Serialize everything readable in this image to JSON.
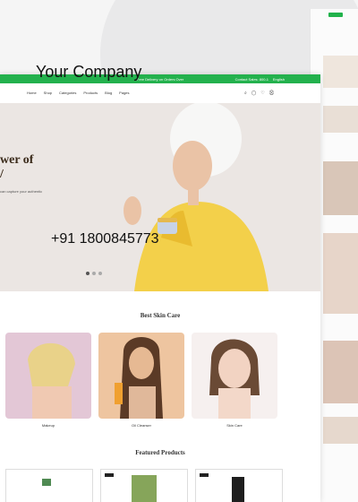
{
  "overlay": {
    "company": "Your Company",
    "phone": "+91 1800845773"
  },
  "topbar": {
    "offer": "Free Delivery on Orders Over",
    "contact": "Contact Sales: 800-1",
    "language": "English"
  },
  "nav": {
    "items": [
      {
        "label": "Home"
      },
      {
        "label": "Shop"
      },
      {
        "label": "Categories"
      },
      {
        "label": "Products"
      },
      {
        "label": "Blog"
      },
      {
        "label": "Pages"
      }
    ]
  },
  "hero": {
    "title_line1": "wer of",
    "title_line2": "/",
    "subtitle": "can capture your authentic"
  },
  "sections": {
    "best": "Best Skin Care",
    "featured": "Featured Products"
  },
  "categories": [
    {
      "label": "Makeup"
    },
    {
      "label": "Oil Cleanser"
    },
    {
      "label": "Skin Care"
    }
  ],
  "colors": {
    "brand_green": "#23b14d",
    "hero_bg": "#ebe6e3"
  }
}
